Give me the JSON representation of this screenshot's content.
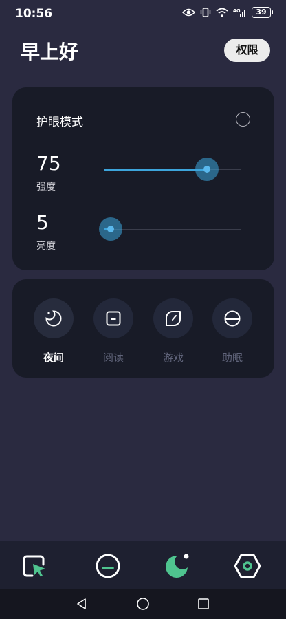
{
  "status_bar": {
    "time": "10:56",
    "battery": "39",
    "network": "4G"
  },
  "header": {
    "greeting": "早上好",
    "permission_button": "权限"
  },
  "eye_card": {
    "mode_title": "护眼模式",
    "mode_enabled": false,
    "intensity": {
      "value": "75",
      "label": "强度",
      "fraction": 0.75
    },
    "brightness": {
      "value": "5",
      "label": "亮度",
      "fraction": 0.05
    }
  },
  "modes": [
    {
      "label": "夜间",
      "icon": "moon-icon",
      "active": true
    },
    {
      "label": "阅读",
      "icon": "book-icon",
      "active": false
    },
    {
      "label": "游戏",
      "icon": "leaf-icon",
      "active": false
    },
    {
      "label": "助眠",
      "icon": "sleep-icon",
      "active": false
    }
  ],
  "bottom_nav": [
    {
      "icon": "cursor-square-icon"
    },
    {
      "icon": "minus-circle-icon"
    },
    {
      "icon": "moon-nav-icon",
      "active": true
    },
    {
      "icon": "hexagon-icon"
    }
  ],
  "colors": {
    "background": "#2a2a40",
    "card": "#181b27",
    "accent": "#3da5dc",
    "nav_active": "#4fc48f"
  }
}
